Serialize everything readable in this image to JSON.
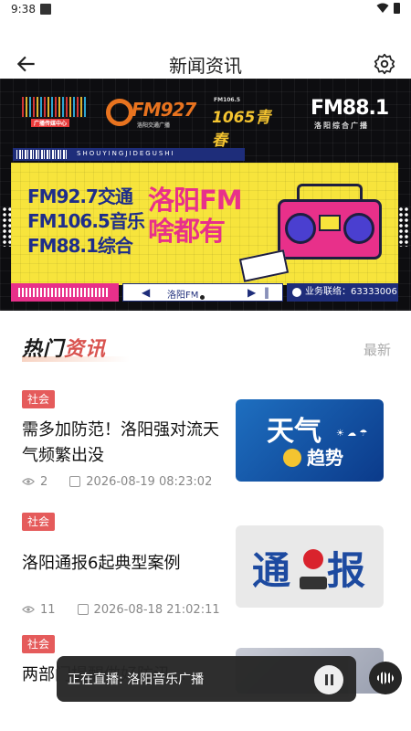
{
  "status_bar": {
    "time": "9:38"
  },
  "app_bar": {
    "title": "新闻资讯",
    "back_icon": "arrow-left-icon",
    "settings_icon": "gear-icon"
  },
  "banner": {
    "logos": {
      "logo1": "广播传媒中心",
      "logo2": "FM927",
      "logo2_sub": "洛阳交通广播",
      "logo3_top": "FM106.5",
      "logo3": "1065青春",
      "logo4": "FM88.1",
      "logo4_sub": "洛阳综合广播"
    },
    "spell": "SHOUYINGJIDEGUSHI",
    "lines": [
      "FM92.7交通",
      "FM106.5音乐",
      "FM88.1综合"
    ],
    "big": [
      "洛阳FM",
      "啥都有"
    ],
    "player_text": "洛阳FM",
    "contact": "业务联络：63333006",
    "page_count": 3,
    "active_page": 1
  },
  "section": {
    "title_a": "热门",
    "title_b": "资讯",
    "more": "最新"
  },
  "news": [
    {
      "tag": "社会",
      "title": "需多加防范！洛阳强对流天气频繁出没",
      "views": "2",
      "date": "2026-08-19 08:23:02",
      "thumb": {
        "t1": "天气",
        "t2": "趋势"
      }
    },
    {
      "tag": "社会",
      "title": "洛阳通报6起典型案例",
      "views": "11",
      "date": "2026-08-18 21:02:11",
      "thumb": {
        "t1": "通",
        "t2": "报"
      }
    },
    {
      "tag": "社会",
      "title": "两部门提醒做好防汛…"
    }
  ],
  "mini_player": {
    "label": "正在直播: 洛阳音乐广播"
  },
  "colors": {
    "tag": "#e55b5b",
    "accent": "#d9534f",
    "poster_yellow": "#f7e43c",
    "poster_pink": "#e8308a",
    "poster_blue": "#1e2d8a"
  }
}
